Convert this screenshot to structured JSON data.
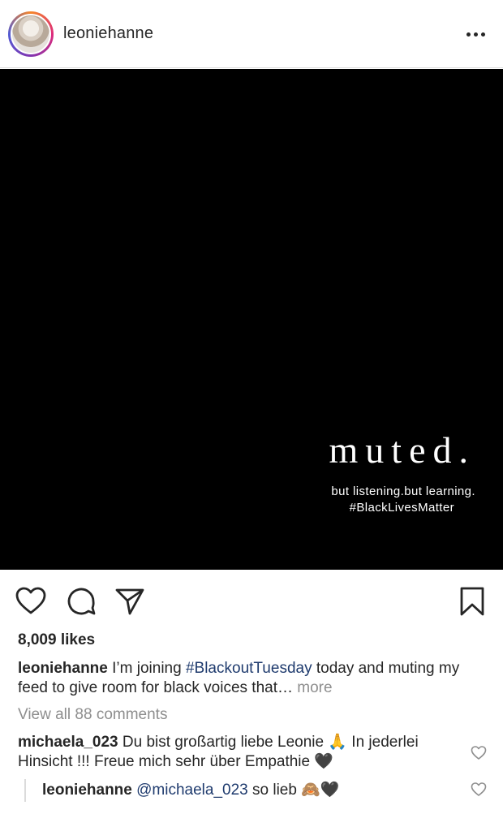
{
  "header": {
    "username": "leoniehanne"
  },
  "image": {
    "headline": "muted.",
    "line1": "but listening.but learning.",
    "line2": "#BlackLivesMatter"
  },
  "post": {
    "likes": "8,009 likes",
    "caption_user": "leoniehanne",
    "caption_pre": " I’m joining ",
    "caption_hashtag": "#BlackoutTuesday",
    "caption_post": " today and muting my feed to give room for black voices that… ",
    "caption_more": "more",
    "view_all": "View all 88 comments"
  },
  "comments": [
    {
      "user": "michaela_023",
      "text": " Du bist großartig liebe Leonie 🙏 In jederlei Hinsicht !!! Freue mich sehr über Empathie 🖤"
    }
  ],
  "reply": {
    "user": "leoniehanne",
    "mention": "@michaela_023",
    "text": " so lieb 🙈🖤"
  },
  "icons": [
    "avatar",
    "more-icon",
    "heart-icon",
    "comment-icon",
    "share-icon",
    "bookmark-icon",
    "heart-small-icon"
  ]
}
